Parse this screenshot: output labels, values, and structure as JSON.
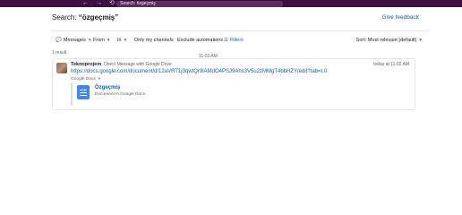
{
  "topbar": {
    "back_icon": "arrow-left-icon",
    "forward_icon": "arrow-right-icon",
    "history_icon": "history-icon",
    "search_text": "Search: özgeçmiş"
  },
  "header": {
    "title_prefix": "Search: ",
    "title_query": "“özgeçmiş”",
    "feedback_label": "Give feedback"
  },
  "filters": {
    "messages": "Messages",
    "from": "From",
    "in": "In",
    "only_my_channels": "Only my channels",
    "exclude_automations": "Exclude automations",
    "filters": "Filters",
    "sort": "Sort: Most relevant (default)"
  },
  "results": {
    "count": "1 result",
    "items": [
      {
        "sender": "Teknoprojem",
        "context": "Direct Message with Google Drive",
        "time": "today at 11:02 AM",
        "link": "https://docs.google.com/document/d/12aVRT1j3qwtQr9lAMdO4PSJ9Ahs3V5u2zMMgT4bbHZY/edit?tab=t.0",
        "app_tag": "Google Docs",
        "attachment": {
          "title": "Özgeçmiş",
          "subtitle": "Document in Google Docs",
          "time": "11:02 AM"
        }
      }
    ]
  },
  "colors": {
    "sidebar_purple": "#3f0e40",
    "link_blue": "#1264a3",
    "docs_blue": "#4285f4"
  }
}
